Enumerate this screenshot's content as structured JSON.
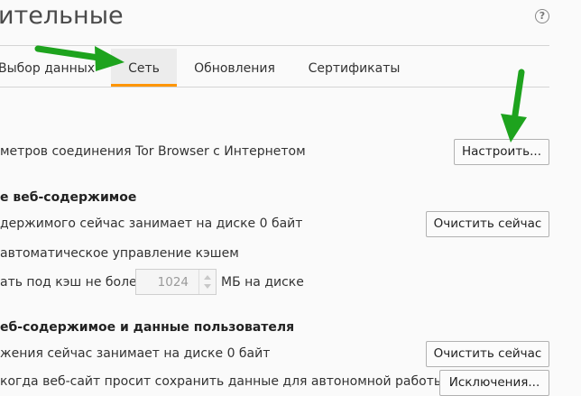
{
  "header": {
    "title": "ительные"
  },
  "tabs": [
    {
      "label": "Выбор данных"
    },
    {
      "label": "Сеть"
    },
    {
      "label": "Обновления"
    },
    {
      "label": "Сертификаты"
    }
  ],
  "connection": {
    "text": "метров соединения Tor Browser с Интернетом",
    "button": "Настроить..."
  },
  "cache": {
    "heading": "е веб-содержимое",
    "usage": "держимого сейчас занимает на диске 0 байт",
    "clear_button": "Очистить сейчас",
    "override_label": "автоматическое управление кэшем",
    "limit_prefix": "ать под кэш не более",
    "limit_value": "1024",
    "limit_suffix": "МБ на диске"
  },
  "offline": {
    "heading": "еб-содержимое и данные пользователя",
    "usage": "жения сейчас занимает на диске 0 байт",
    "clear_button": "Очистить сейчас",
    "ask_label": "когда веб-сайт просит сохранить данные для автономной работы",
    "exceptions_button": "Исключения..."
  },
  "annotations": {
    "arrow_color": "#1ea31e"
  }
}
